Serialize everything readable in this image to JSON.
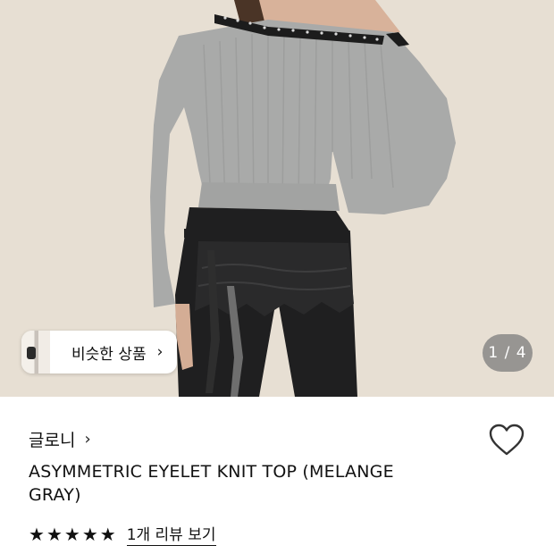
{
  "gallery": {
    "counter": "1 / 4",
    "similar_label": "비슷한 상품",
    "chevron": "›"
  },
  "product": {
    "brand": "글로니",
    "brand_chevron": "›",
    "title": "ASYMMETRIC EYELET KNIT TOP (MELANGE GRAY)",
    "rating_stars": 5,
    "review_link": "1개 리뷰 보기",
    "icons": {
      "wishlist": "heart-outline-icon",
      "star": "star-filled-icon"
    }
  }
}
